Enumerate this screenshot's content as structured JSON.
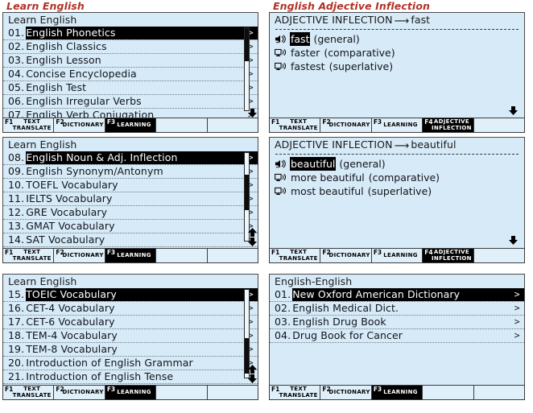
{
  "captions": {
    "left": "Learn English",
    "right": "English Adjective Inflection"
  },
  "fkeys": {
    "f1": {
      "num": "F1",
      "label": "TEXT TRANSLATE"
    },
    "f2": {
      "num": "F2",
      "label": "DICTIONARY"
    },
    "f3": {
      "num": "F3",
      "label": "LEARNING"
    },
    "f4": {
      "num": "F4",
      "label": "ADJECTIVE INFLECTION"
    },
    "blank": {
      "num": "",
      "label": ""
    }
  },
  "panels": {
    "left_top": {
      "title": "Learn English",
      "rows": [
        {
          "num": "01.",
          "label": "English Phonetics",
          "chev": ">",
          "selected": true
        },
        {
          "num": "02.",
          "label": "English Classics",
          "chev": ">",
          "selected": false
        },
        {
          "num": "03.",
          "label": "English Lesson",
          "chev": ">",
          "selected": false
        },
        {
          "num": "04.",
          "label": "Concise Encyclopedia",
          "chev": ">",
          "selected": false
        },
        {
          "num": "05.",
          "label": "English Test",
          "chev": ">",
          "selected": false
        },
        {
          "num": "06.",
          "label": "English Irregular Verbs",
          "chev": ">",
          "selected": false
        },
        {
          "num": "07.",
          "label": "English Verb Conjugation",
          "chev": ">",
          "selected": false
        }
      ],
      "scroll": {
        "thumb_top": "0%",
        "thumb_height": "40%",
        "up": false,
        "down": true
      }
    },
    "left_mid": {
      "title": "Learn English",
      "rows": [
        {
          "num": "08.",
          "label": "English Noun & Adj. Inflection",
          "chev": ">",
          "selected": true
        },
        {
          "num": "09.",
          "label": "English Synonym/Antonym",
          "chev": ">",
          "selected": false
        },
        {
          "num": "10.",
          "label": "TOEFL Vocabulary",
          "chev": ">",
          "selected": false
        },
        {
          "num": "11.",
          "label": "IELTS Vocabulary",
          "chev": ">",
          "selected": false
        },
        {
          "num": "12.",
          "label": "GRE Vocabulary",
          "chev": ">",
          "selected": false
        },
        {
          "num": "13.",
          "label": "GMAT Vocabulary",
          "chev": ">",
          "selected": false
        },
        {
          "num": "14.",
          "label": "SAT Vocabulary",
          "chev": ">",
          "selected": false
        }
      ],
      "scroll": {
        "thumb_top": "25%",
        "thumb_height": "40%",
        "up": true,
        "down": true
      }
    },
    "left_bottom": {
      "title": "Learn English",
      "rows": [
        {
          "num": "15.",
          "label": "TOEIC Vocabulary",
          "chev": ">",
          "selected": true
        },
        {
          "num": "16.",
          "label": "CET-4 Vocabulary",
          "chev": ">",
          "selected": false
        },
        {
          "num": "17.",
          "label": "CET-6 Vocabulary",
          "chev": ">",
          "selected": false
        },
        {
          "num": "18.",
          "label": "TEM-4 Vocabulary",
          "chev": ">",
          "selected": false
        },
        {
          "num": "19.",
          "label": "TEM-8 Vocabulary",
          "chev": ">",
          "selected": false
        },
        {
          "num": "20.",
          "label": "Introduction of English Grammar",
          "chev": ">",
          "selected": false
        },
        {
          "num": "21.",
          "label": "Introduction of English Tense",
          "chev": ">",
          "selected": false
        }
      ],
      "scroll": {
        "thumb_top": "55%",
        "thumb_height": "40%",
        "up": true,
        "down": true
      }
    },
    "right_top": {
      "title_prefix": "ADJECTIVE INFLECTION",
      "title_arrow": "⟶",
      "title_word": "fast",
      "rows": [
        {
          "icon": "speaker-filled-icon",
          "word": "fast",
          "kind": "(general)",
          "selected": true
        },
        {
          "icon": "speaker-outline-icon",
          "word": "faster",
          "kind": "(comparative)",
          "selected": false
        },
        {
          "icon": "speaker-outline-icon",
          "word": "fastest",
          "kind": "(superlative)",
          "selected": false
        }
      ],
      "down": true
    },
    "right_mid": {
      "title_prefix": "ADJECTIVE INFLECTION",
      "title_arrow": "⟶",
      "title_word": "beautiful",
      "rows": [
        {
          "icon": "speaker-filled-icon",
          "word": "beautiful",
          "kind": "(general)",
          "selected": true
        },
        {
          "icon": "speaker-outline-icon",
          "word": "more beautiful",
          "kind": "(comparative)",
          "selected": false
        },
        {
          "icon": "speaker-outline-icon",
          "word": "most beautiful",
          "kind": "(superlative)",
          "selected": false
        }
      ],
      "down": true
    },
    "right_bottom": {
      "title": "English-English",
      "rows": [
        {
          "num": "01.",
          "label": "New Oxford American Dictionary",
          "chev": ">",
          "selected": true
        },
        {
          "num": "02.",
          "label": "English Medical Dict.",
          "chev": ">",
          "selected": false
        },
        {
          "num": "03.",
          "label": "English Drug Book",
          "chev": ">",
          "selected": false
        },
        {
          "num": "04.",
          "label": "Drug Book for Cancer",
          "chev": ">",
          "selected": false
        }
      ]
    }
  },
  "colors": {
    "caption": "#b23226",
    "screen_bg": "#d7eaf7",
    "fbar_bg": "#dff0fb",
    "selected_bg": "#000000",
    "border": "#3c3c3c"
  }
}
